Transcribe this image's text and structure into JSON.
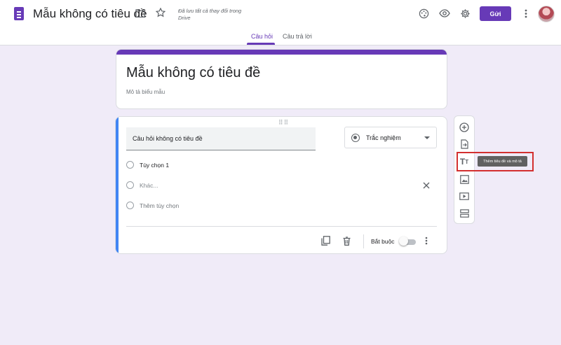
{
  "header": {
    "doc_title": "Mẫu không có tiêu đề",
    "save_status": "Đã lưu tất cả thay đổi trong Drive",
    "send_label": "Gửi"
  },
  "tabs": [
    {
      "label": "Câu hỏi",
      "active": true
    },
    {
      "label": "Câu trả lời",
      "active": false
    }
  ],
  "form": {
    "title": "Mẫu không có tiêu đề",
    "description_placeholder": "Mô tả biểu mẫu"
  },
  "question": {
    "text": "Câu hỏi không có tiêu đề",
    "type": "Trắc nghiệm",
    "options": [
      "Tùy chọn 1",
      "Khác...",
      "Thêm tùy chọn"
    ],
    "required_label": "Bắt buộc",
    "required": false
  },
  "side_toolbar": {
    "tooltip": "Thêm tiêu đề và mô tả",
    "items": [
      "add-question",
      "import-questions",
      "add-title-description",
      "add-image",
      "add-video",
      "add-section"
    ]
  },
  "colors": {
    "accent": "#673ab7",
    "background": "#f0ebf8",
    "question_focus": "#4285f4",
    "highlight": "#d32f2f"
  }
}
